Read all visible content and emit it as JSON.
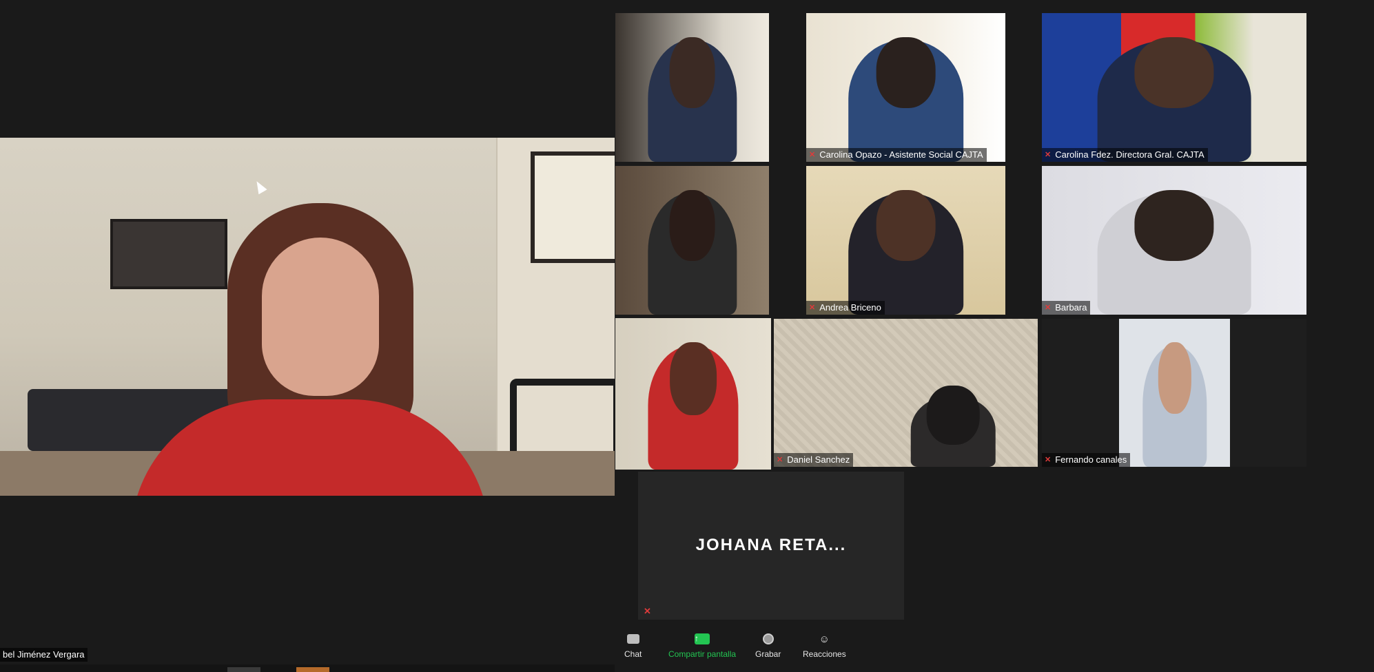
{
  "speaker": {
    "name": "bel Jiménez Vergara"
  },
  "gallery": {
    "tiles": [
      {
        "name": ""
      },
      {
        "name": "Carolina Opazo - Asistente Social CAJTA",
        "muted": true
      },
      {
        "name": "Carolina Fdez. Directora Gral. CAJTA",
        "muted": true
      },
      {
        "name": ""
      },
      {
        "name": "Andrea Briceno",
        "muted": true
      },
      {
        "name": "Barbara",
        "muted": true
      },
      {
        "name": "",
        "active": true
      },
      {
        "name": "Daniel  Sanchez",
        "muted": true
      },
      {
        "name": "Fernando canales",
        "muted": true
      }
    ],
    "name_only_tile": {
      "name": "JOHANA  RETA..."
    }
  },
  "toolbar": {
    "chat": "Chat",
    "share": "Compartir pantalla",
    "record": "Grabar",
    "reactions": "Reacciones"
  },
  "colors": {
    "background": "#1a1a1a",
    "active_speaker_border": "#e2e64b",
    "share_green": "#23c552",
    "muted_red": "#e03b3b"
  },
  "icons": [
    "mic-muted-icon",
    "chat-icon",
    "share-screen-icon",
    "record-icon",
    "reactions-icon",
    "mouse-cursor-icon"
  ]
}
